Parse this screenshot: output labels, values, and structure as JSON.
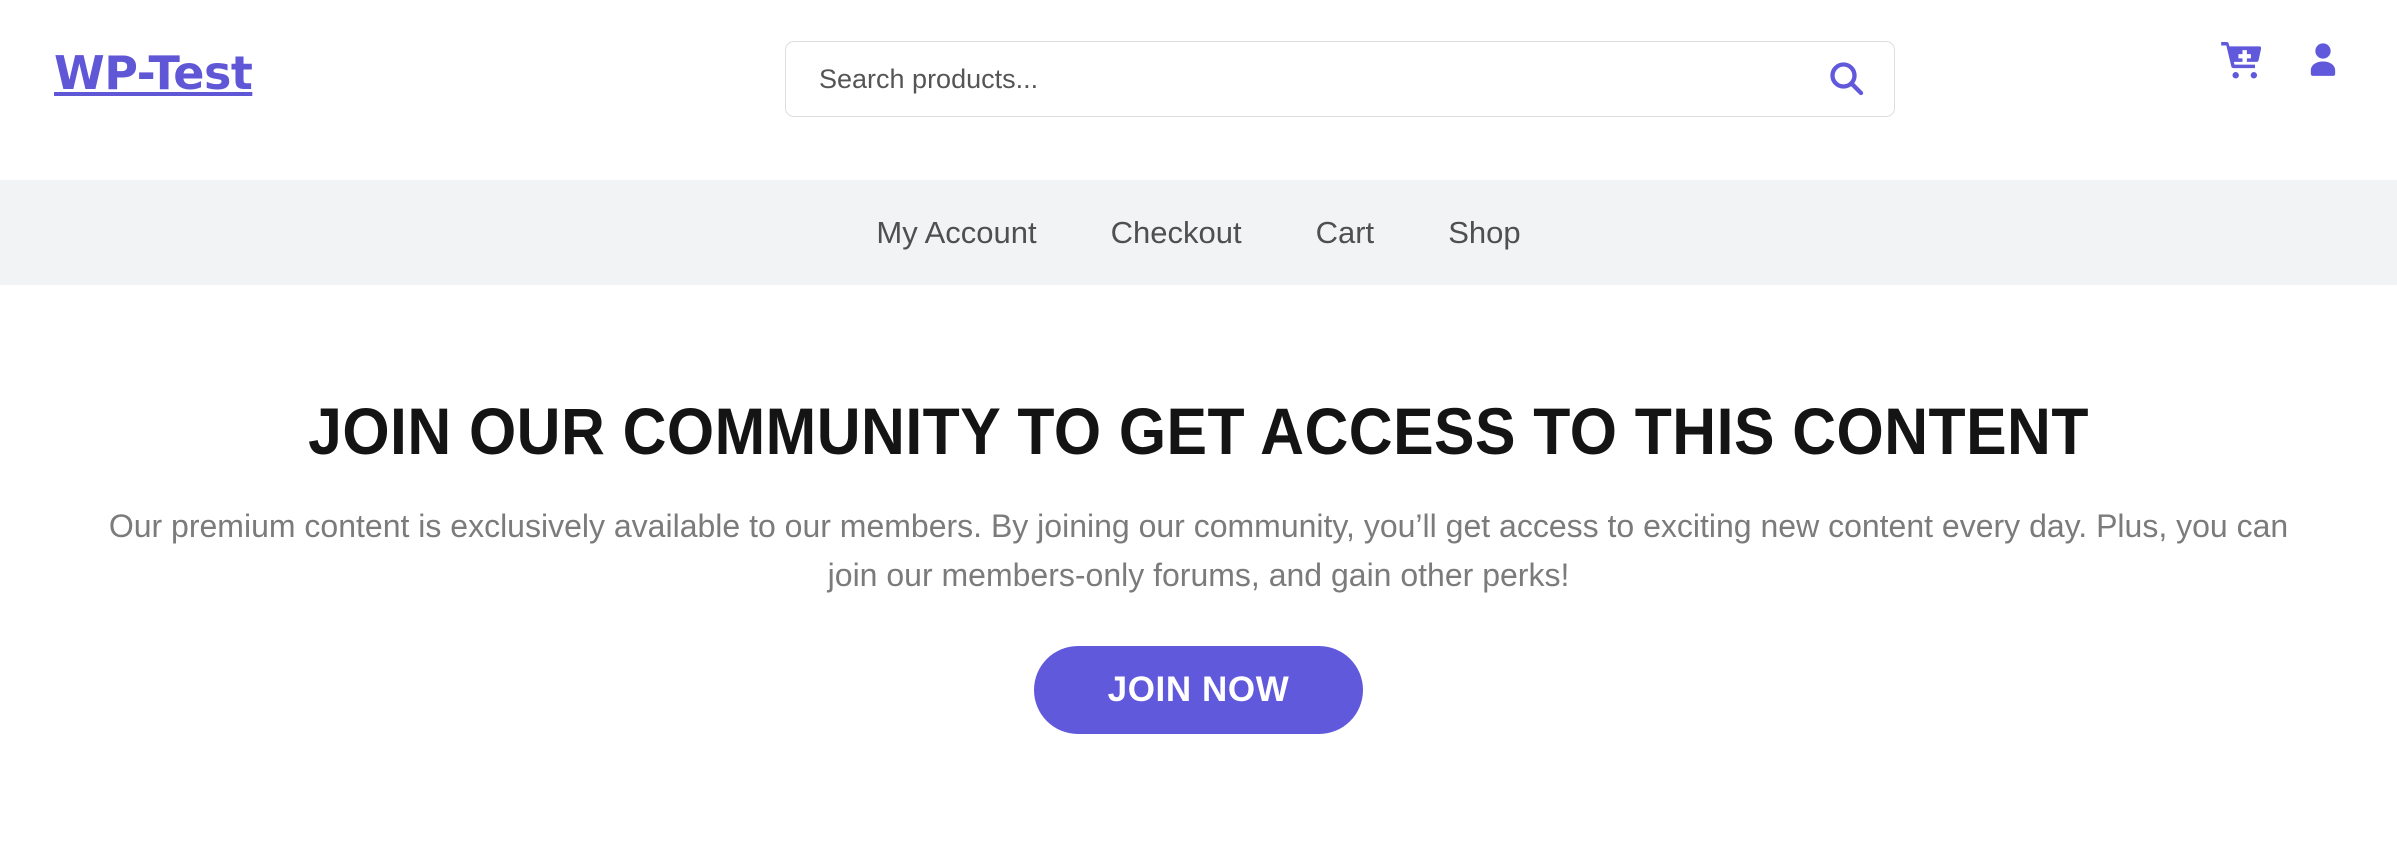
{
  "header": {
    "brand": "WP-Test",
    "search": {
      "placeholder": "Search products...",
      "value": "",
      "submit_label": "Search",
      "icon": "search-icon"
    },
    "icons": [
      {
        "name": "cart-add-icon",
        "label": "Add to cart"
      },
      {
        "name": "user-account-icon",
        "label": "My account"
      }
    ]
  },
  "nav": {
    "items": [
      {
        "label": "My Account"
      },
      {
        "label": "Checkout"
      },
      {
        "label": "Cart"
      },
      {
        "label": "Shop"
      }
    ]
  },
  "main": {
    "title": "Join Our Community To Get Access To This Content",
    "description": "Our premium content is exclusively available to our members. By joining our community, you’ll get access to exciting new content every day. Plus, you can join our members-only forums, and gain other perks!",
    "cta_label": "Join Now"
  },
  "colors": {
    "brand_purple": "#5f57d6",
    "button_purple": "#6159db",
    "nav_bar_bg": "#f2f3f5",
    "heading_text": "#141414",
    "body_text": "#7b7b7b",
    "nav_text": "#4f4f4f",
    "page_bg": "#ffffff",
    "search_border": "#dcdee2"
  }
}
